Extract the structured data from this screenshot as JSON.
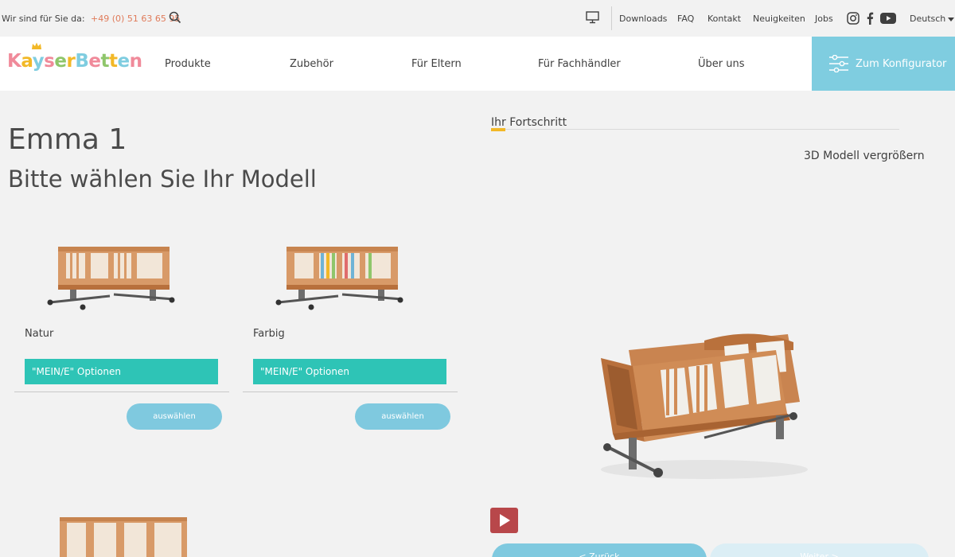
{
  "topbar": {
    "contact_label": "Wir sind für Sie da:",
    "phone": "+49 (0) 51 63 65 95",
    "links": [
      "Downloads",
      "FAQ",
      "Kontakt",
      "Neuigkeiten",
      "Jobs"
    ],
    "language": "Deutsch",
    "icons": [
      "search-icon",
      "monitor-icon",
      "instagram-icon",
      "facebook-icon",
      "youtube-icon"
    ]
  },
  "nav": {
    "logo_text": "KayserBetten",
    "items": [
      "Produkte",
      "Zubehör",
      "Für Eltern",
      "Für Fachhändler",
      "Über uns"
    ],
    "configurator_label": "Zum Konfigurator"
  },
  "page": {
    "title": "Emma 1",
    "subtitle": "Bitte wählen Sie Ihr Modell"
  },
  "models": [
    {
      "name": "Natur",
      "options_label": "\"MEIN/E\" Optionen",
      "select_label": "auswählen"
    },
    {
      "name": "Farbig",
      "options_label": "\"MEIN/E\" Optionen",
      "select_label": "auswählen"
    }
  ],
  "progress": {
    "title": "Ihr Fortschritt",
    "enlarge_label": "3D Modell vergrößern",
    "back_label": "< Zurück",
    "next_label": "Weiter >"
  },
  "colors": {
    "brand_blue": "#7fcde0",
    "teal": "#2ec4b6",
    "accent_yellow": "#f2b827",
    "phone_orange": "#e07b5a",
    "play_red": "#b8474a"
  }
}
